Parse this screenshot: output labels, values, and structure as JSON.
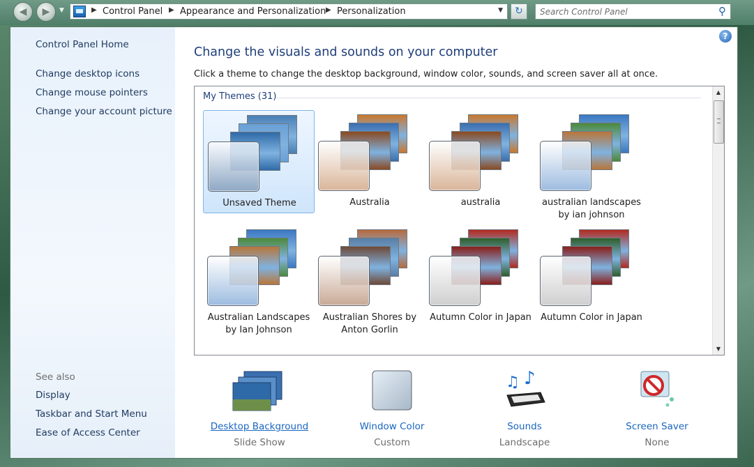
{
  "address_bar": {
    "breadcrumbs": [
      "Control Panel",
      "Appearance and Personalization",
      "Personalization"
    ],
    "search_placeholder": "Search Control Panel"
  },
  "sidebar": {
    "home": "Control Panel Home",
    "tasks": [
      "Change desktop icons",
      "Change mouse pointers",
      "Change your account picture"
    ],
    "see_also_label": "See also",
    "see_also": [
      "Display",
      "Taskbar and Start Menu",
      "Ease of Access Center"
    ]
  },
  "main": {
    "title": "Change the visuals and sounds on your computer",
    "description": "Click a theme to change the desktop background, window color, sounds, and screen saver all at once.",
    "group_header": "My Themes (31)",
    "themes": [
      {
        "label": "Unsaved Theme",
        "selected": true,
        "swatch": "#8fa8c4",
        "card_colors": [
          "#4a7fb5",
          "#6aa0d6",
          "#2f6aa8"
        ]
      },
      {
        "label": "Australia",
        "selected": false,
        "swatch": "#d9b59a",
        "card_colors": [
          "#c9782f",
          "#3b6fb0",
          "#8a4a22"
        ]
      },
      {
        "label": "australia",
        "selected": false,
        "swatch": "#d9b59a",
        "card_colors": [
          "#c9782f",
          "#3b6fb0",
          "#8a4a22"
        ]
      },
      {
        "label": "australian landscapes by ian johnson",
        "selected": false,
        "swatch": "#9dbce0",
        "card_colors": [
          "#3b78c2",
          "#4c8a3a",
          "#b9763a"
        ]
      },
      {
        "label": "Australian Landscapes by Ian Johnson",
        "selected": false,
        "swatch": "#9dbce0",
        "card_colors": [
          "#3b78c2",
          "#4c8a3a",
          "#b9763a"
        ]
      },
      {
        "label": "Australian Shores by Anton Gorlin",
        "selected": false,
        "swatch": "#c9aa97",
        "card_colors": [
          "#b86a3c",
          "#5a7fa6",
          "#6e4a38"
        ]
      },
      {
        "label": "Autumn Color in Japan",
        "selected": false,
        "swatch": "#cfcfcf",
        "card_colors": [
          "#b32a1f",
          "#2f5e2a",
          "#8a1e1a"
        ]
      },
      {
        "label": "Autumn Color in Japan",
        "selected": false,
        "swatch": "#cfcfcf",
        "card_colors": [
          "#b32a1f",
          "#2f5e2a",
          "#8a1e1a"
        ]
      }
    ]
  },
  "settings": [
    {
      "label": "Desktop Background",
      "value": "Slide Show",
      "icon": "desktop-background-icon"
    },
    {
      "label": "Window Color",
      "value": "Custom",
      "icon": "window-color-icon"
    },
    {
      "label": "Sounds",
      "value": "Landscape",
      "icon": "sounds-icon"
    },
    {
      "label": "Screen Saver",
      "value": "None",
      "icon": "screen-saver-icon"
    }
  ]
}
